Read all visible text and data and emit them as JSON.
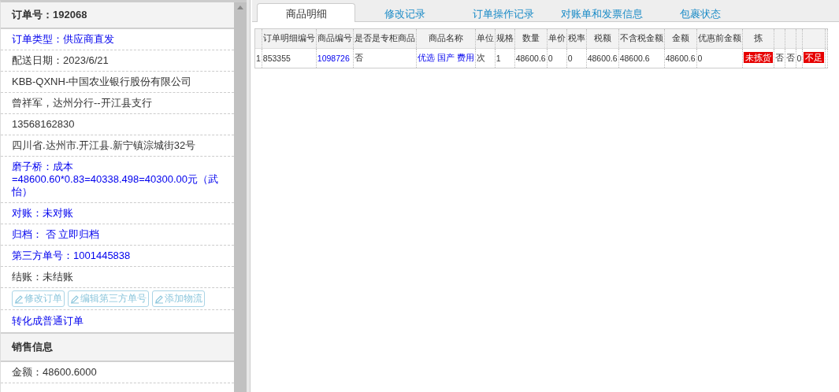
{
  "order_panel": {
    "title": "订单号：192068",
    "rows": [
      {
        "text": "订单类型：供应商直发",
        "kind": "link"
      },
      {
        "text": "配送日期：2023/6/21",
        "kind": "plain"
      },
      {
        "text": "KBB-QXNH-中国农业银行股份有限公司",
        "kind": "plain"
      },
      {
        "text": "曾祥军，达州分行--开江县支行",
        "kind": "plain"
      },
      {
        "text": "13568162830",
        "kind": "plain"
      },
      {
        "text": "四川省.达州市.开江县.新宁镇淙城街32号",
        "kind": "plain"
      },
      {
        "text": "磨子桥：成本=48600.60*0.83=40338.498=40300.00元（武怡）",
        "kind": "link"
      },
      {
        "text": "对账：未对账",
        "kind": "link"
      },
      {
        "text": "归档： 否 立即归档",
        "kind": "link"
      },
      {
        "text": "第三方单号：1001445838",
        "kind": "link"
      },
      {
        "text": "结账：未结账",
        "kind": "plain"
      }
    ],
    "buttons": [
      {
        "label": "修改订单",
        "disabled": true
      },
      {
        "label": "编辑第三方单号",
        "disabled": true
      },
      {
        "label": "添加物流",
        "disabled": true
      }
    ],
    "convert_link": "转化成普通订单",
    "sales_title": "销售信息",
    "sales_rows": [
      "金额：48600.6000"
    ]
  },
  "tabs": [
    {
      "label": "商品明细",
      "selected": true
    },
    {
      "label": "修改记录",
      "selected": false
    },
    {
      "label": "订单操作记录",
      "selected": false
    },
    {
      "label": "对账单和发票信息",
      "selected": false
    },
    {
      "label": "包裹状态",
      "selected": false
    }
  ],
  "table": {
    "columns": [
      "",
      "订单明细编号",
      "商品编号",
      "是否是专柜商品",
      "商品名称",
      "单位",
      "规格",
      "数量",
      "单价",
      "税率",
      "税额",
      "不含税金额",
      "金额",
      "优惠前金额",
      "拣"
    ],
    "rows": [
      {
        "cells": [
          {
            "text": "1",
            "kind": "plain"
          },
          {
            "text": "853355",
            "kind": "plain"
          },
          {
            "text": "1098726",
            "kind": "link"
          },
          {
            "text": "否",
            "kind": "plain"
          },
          {
            "text": "优选 国产 费用",
            "kind": "link"
          },
          {
            "text": "次",
            "kind": "plain"
          },
          {
            "text": "1",
            "kind": "plain"
          },
          {
            "text": "48600.6",
            "kind": "plain"
          },
          {
            "text": "0",
            "kind": "plain"
          },
          {
            "text": "0",
            "kind": "plain"
          },
          {
            "text": "48600.6",
            "kind": "plain"
          },
          {
            "text": "48600.6",
            "kind": "plain"
          },
          {
            "text": "48600.6",
            "kind": "plain"
          },
          {
            "text": "0",
            "kind": "plain"
          },
          {
            "text": "未拣货",
            "kind": "alert"
          },
          {
            "text": "否",
            "kind": "plain"
          },
          {
            "text": "否",
            "kind": "plain"
          },
          {
            "text": "0",
            "kind": "plain"
          },
          {
            "text": "不足",
            "kind": "alert"
          }
        ]
      }
    ]
  }
}
